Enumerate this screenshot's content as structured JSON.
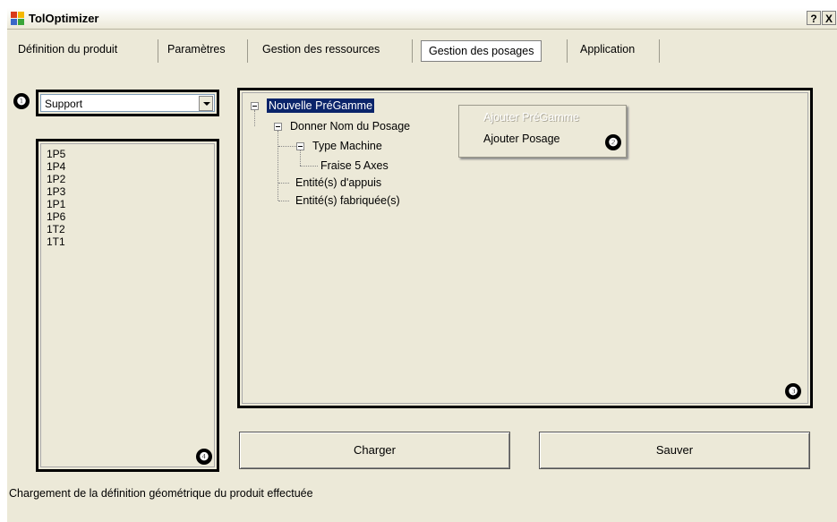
{
  "window": {
    "title": "TolOptimizer",
    "help_button": "?",
    "close_button": "X"
  },
  "tabs": [
    {
      "label": "Définition du produit"
    },
    {
      "label": "Paramètres"
    },
    {
      "label": "Gestion des ressources"
    },
    {
      "label": "Gestion des posages",
      "active": true
    },
    {
      "label": "Application"
    }
  ],
  "markers": [
    "❶",
    "❷",
    "❸",
    "❹"
  ],
  "combo": {
    "selected": "Support"
  },
  "list": {
    "items": [
      "1P5",
      "1P4",
      "1P2",
      "1P3",
      "1P1",
      "1P6",
      "1T2",
      "1T1"
    ]
  },
  "tree": {
    "root": "Nouvelle PréGamme",
    "pose": "Donner Nom du Posage",
    "machine_type": "Type Machine",
    "machine": "Fraise 5 Axes",
    "support_entities": "Entité(s) d'appuis",
    "made_entities": "Entité(s) fabriquée(s)"
  },
  "context_menu": {
    "items": [
      {
        "label": "Ajouter PréGamme",
        "enabled": false
      },
      {
        "label": "Ajouter Posage",
        "enabled": true
      }
    ]
  },
  "buttons": {
    "load": "Charger",
    "save": "Sauver"
  },
  "status": "Chargement de la définition géométrique du produit effectuée"
}
